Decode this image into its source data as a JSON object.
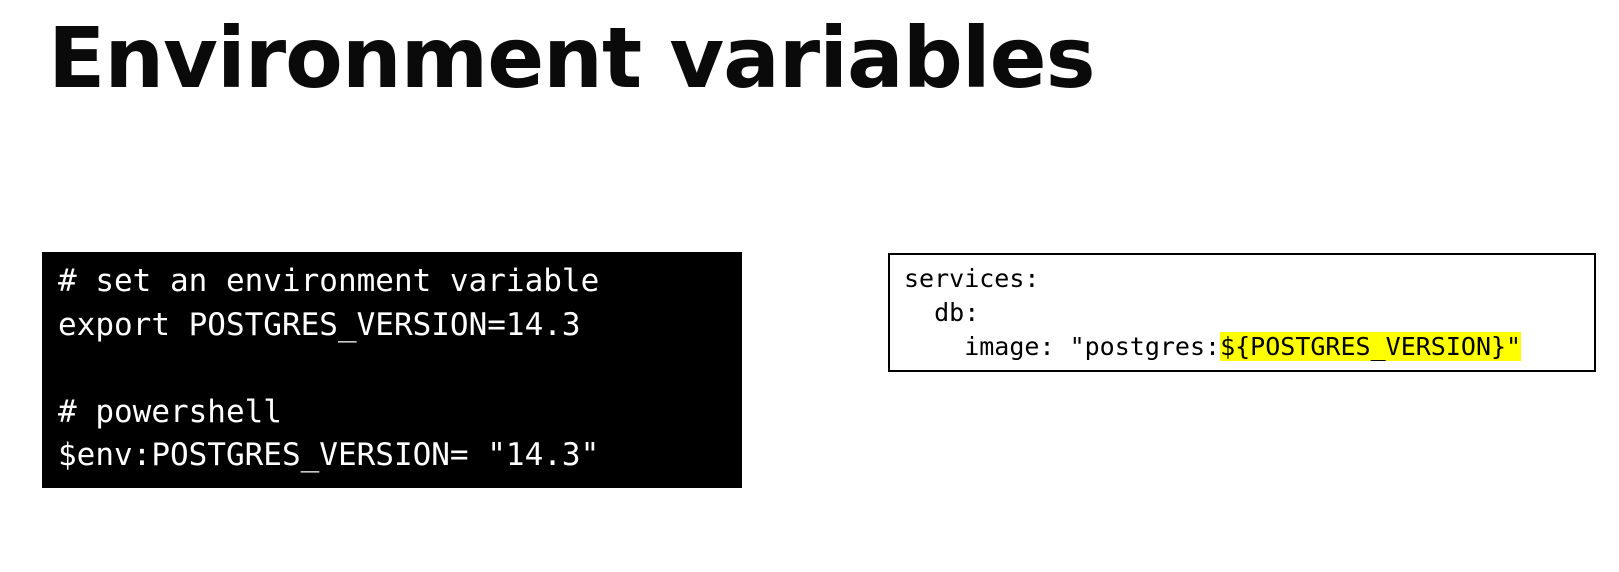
{
  "slide": {
    "title": "Environment variables"
  },
  "shell_block": {
    "lines": [
      "# set an environment variable",
      "export POSTGRES_VERSION=14.3",
      "",
      "# powershell",
      "$env:POSTGRES_VERSION= \"14.3\""
    ]
  },
  "compose_block": {
    "line1": "services:",
    "line2": "  db:",
    "line3_prefix": "    image: \"postgres:",
    "line3_highlight": "${POSTGRES_VERSION}\"",
    "highlight_color": "#ffff00"
  },
  "colors": {
    "terminal_background": "#000000",
    "terminal_text": "#ffffff",
    "title_text": "#0a0a0a"
  }
}
